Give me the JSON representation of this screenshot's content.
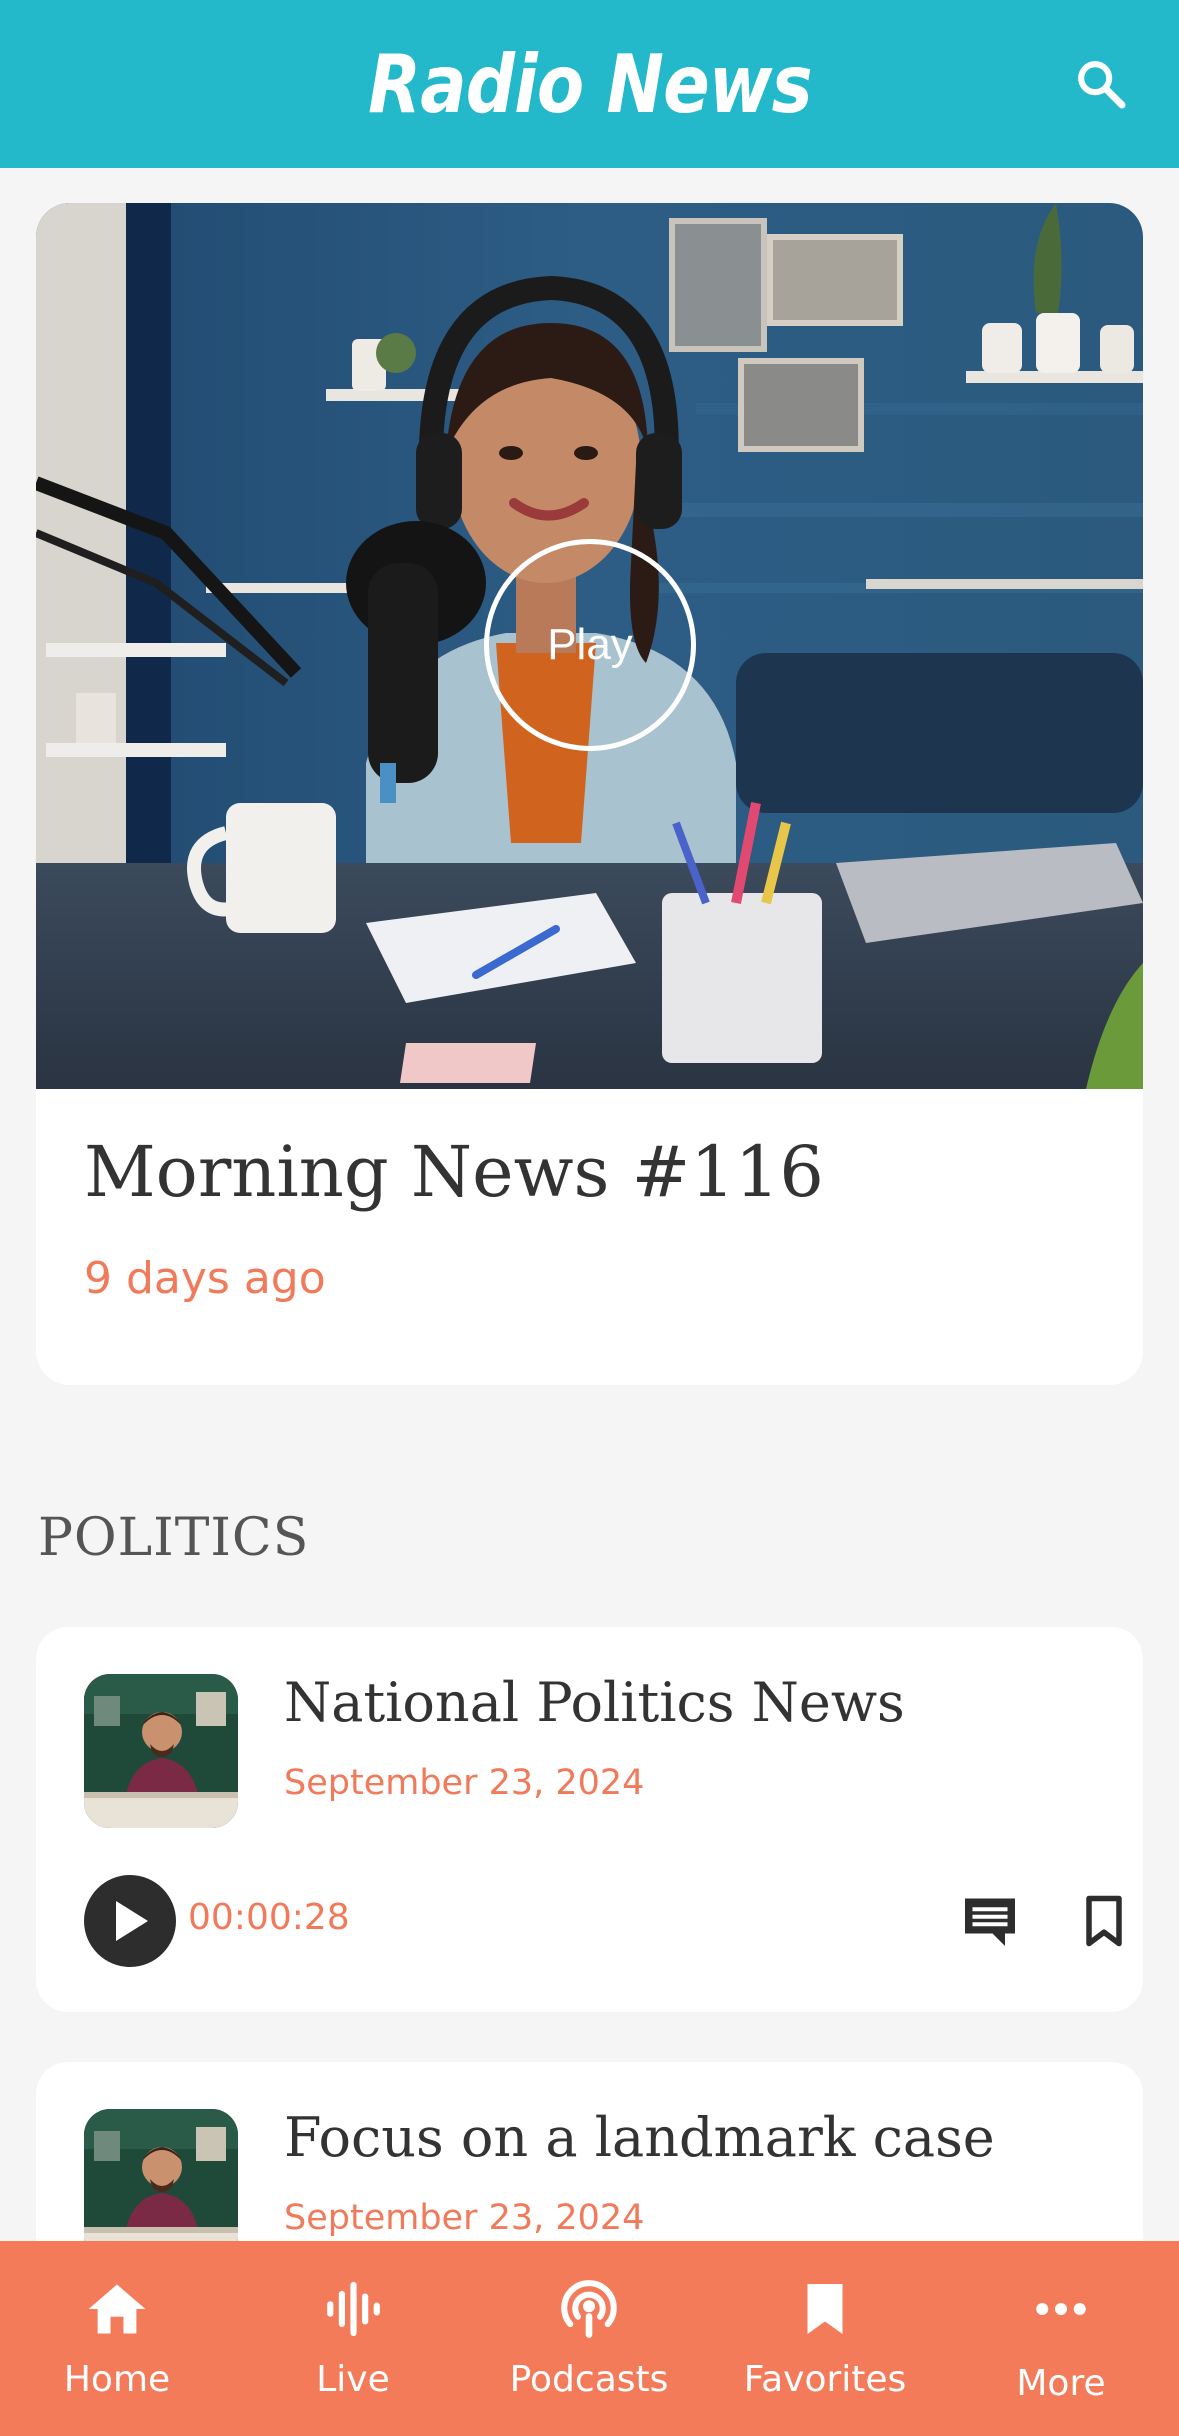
{
  "header": {
    "title": "Radio News",
    "search_icon": "search-icon"
  },
  "featured": {
    "play_label": "Play",
    "title": "Morning News #116",
    "time_ago": "9 days ago"
  },
  "sections": [
    {
      "title": "POLITICS",
      "items": [
        {
          "title": "National Politics News",
          "date": "September 23, 2024",
          "duration": "00:00:28"
        },
        {
          "title": "Focus on a landmark case",
          "date": "September 23, 2024"
        }
      ]
    }
  ],
  "bottom_nav": {
    "items": [
      {
        "label": "Home",
        "icon": "home-icon"
      },
      {
        "label": "Live",
        "icon": "waveform-icon"
      },
      {
        "label": "Podcasts",
        "icon": "podcast-icon"
      },
      {
        "label": "Favorites",
        "icon": "bookmark-icon"
      },
      {
        "label": "More",
        "icon": "more-dots-icon"
      }
    ]
  },
  "colors": {
    "header_bg": "#24b8cb",
    "accent": "#f07a5a",
    "nav_bg": "#f47b5a",
    "page_bg": "#f5f5f5"
  }
}
